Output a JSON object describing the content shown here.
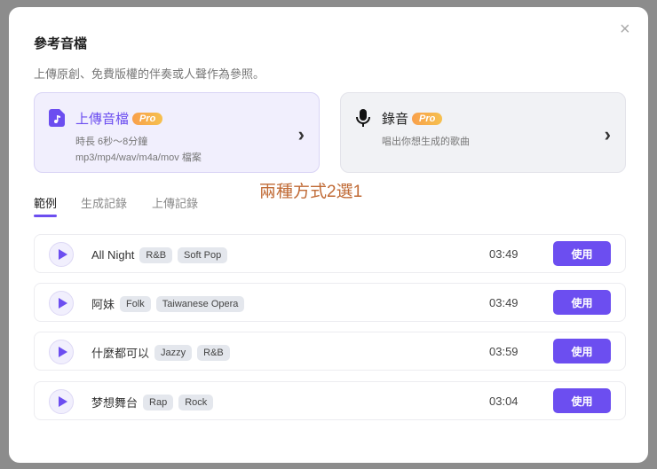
{
  "dialog": {
    "title": "參考音檔",
    "subtitle": "上傳原創、免費版權的伴奏或人聲作為參照。",
    "close": "×"
  },
  "cards": [
    {
      "title": "上傳音檔",
      "badge": "Pro",
      "lines": [
        "時長 6秒～8分鐘",
        "mp3/mp4/wav/m4a/mov 檔案"
      ]
    },
    {
      "title": "錄音",
      "badge": "Pro",
      "lines": [
        "唱出你想生成的歌曲"
      ]
    }
  ],
  "annotation": "兩種方式2選1",
  "tabs": [
    "範例",
    "生成記錄",
    "上傳記錄"
  ],
  "active_tab": "範例",
  "accent": "#6c4ef0",
  "tracks": [
    {
      "name": "All Night",
      "tags": [
        "R&B",
        "Soft Pop"
      ],
      "duration": "03:49",
      "action": "使用"
    },
    {
      "name": "阿妹",
      "tags": [
        "Folk",
        "Taiwanese Opera"
      ],
      "duration": "03:49",
      "action": "使用"
    },
    {
      "name": "什麼都可以",
      "tags": [
        "Jazzy",
        "R&B"
      ],
      "duration": "03:59",
      "action": "使用"
    },
    {
      "name": "梦想舞台",
      "tags": [
        "Rap",
        "Rock"
      ],
      "duration": "03:04",
      "action": "使用"
    }
  ]
}
